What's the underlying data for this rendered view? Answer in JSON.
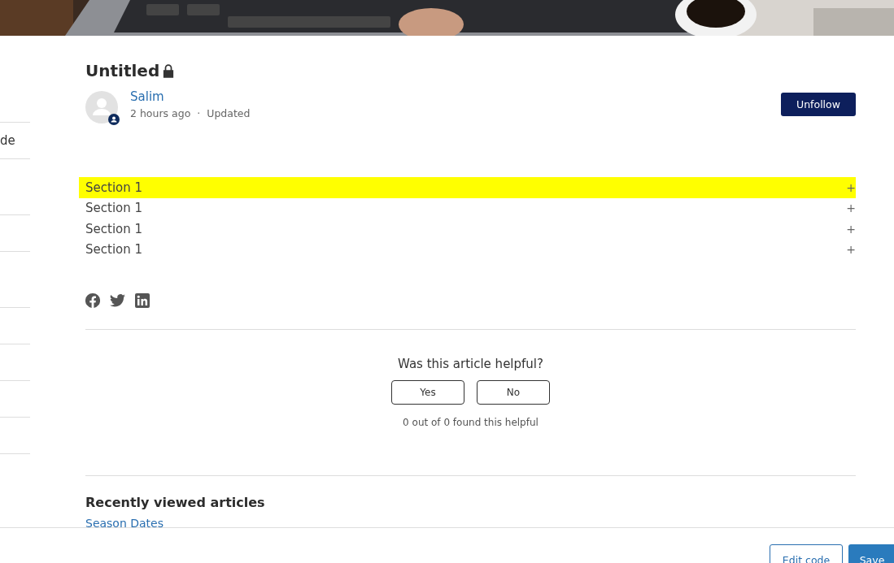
{
  "sidebar": {
    "items": [
      "de"
    ]
  },
  "article": {
    "title": "Untitled",
    "locked": true,
    "author": "Salim",
    "time": "2 hours ago",
    "separator": "·",
    "status": "Updated",
    "follow_button": "Unfollow"
  },
  "sections": [
    {
      "label": "Section 1",
      "expand": "+",
      "highlighted": true
    },
    {
      "label": "Section 1",
      "expand": "+",
      "highlighted": false
    },
    {
      "label": "Section 1",
      "expand": "+",
      "highlighted": false
    },
    {
      "label": "Section 1",
      "expand": "+",
      "highlighted": false
    }
  ],
  "feedback": {
    "question": "Was this article helpful?",
    "buttons": [
      "Yes",
      "No"
    ],
    "count": "0 out of 0 found this helpful"
  },
  "recently_viewed": {
    "heading": "Recently viewed articles",
    "items": [
      "Season Dates"
    ]
  },
  "bottom_bar": {
    "buttons": [
      {
        "label": "Edit code",
        "kind": "secondary"
      },
      {
        "label": "Save",
        "kind": "primary"
      }
    ]
  }
}
